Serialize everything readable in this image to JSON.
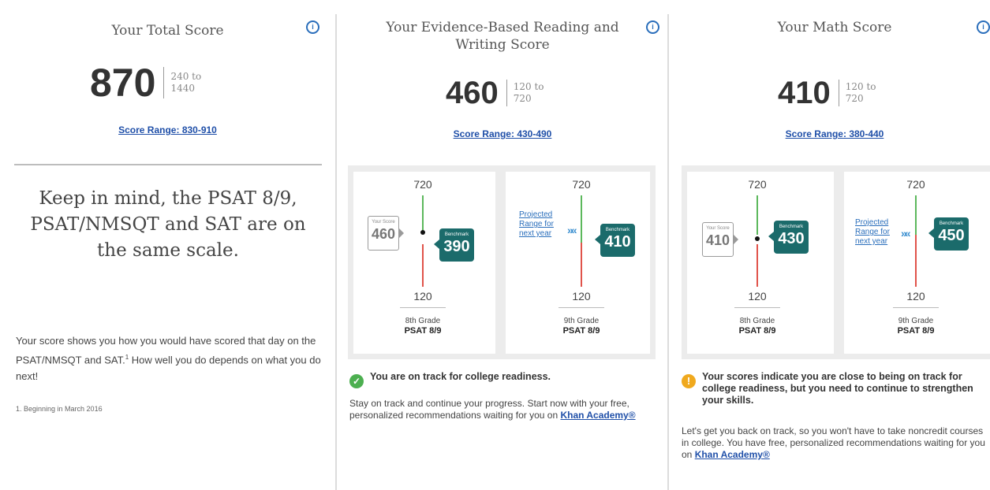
{
  "total": {
    "title": "Your Total Score",
    "score": "870",
    "range_from": "240 to",
    "range_to": "1440",
    "score_range": "Score Range: 830-910",
    "keep_in_mind": "Keep in mind, the PSAT 8/9, PSAT/NMSQT and SAT are on the same scale.",
    "explain_pre": "Your score shows you how you would have scored that day on the PSAT/NMSQT and SAT.",
    "explain_sup": "1",
    "explain_post": " How well you do depends on what you do next!",
    "footnote": "1. Beginning in March 2016"
  },
  "ebrw": {
    "title": "Your Evidence-Based Reading and Writing Score",
    "score": "460",
    "range_from": "120 to",
    "range_to": "720",
    "score_range": "Score Range: 430-490",
    "left": {
      "top": "720",
      "bottom": "120",
      "your_score_label": "Your Score",
      "your_score": "460",
      "benchmark_label": "Benchmark",
      "benchmark": "390",
      "grade": "8th Grade",
      "test": "PSAT 8/9"
    },
    "right": {
      "top": "720",
      "bottom": "120",
      "projected": "Projected Range for next year",
      "benchmark_label": "Benchmark",
      "benchmark": "410",
      "grade": "9th Grade",
      "test": "PSAT 8/9"
    },
    "status": "You are on track for college readiness.",
    "body": "Stay on track and continue your progress. Start now with your free, personalized recommendations waiting for you on ",
    "link": "Khan Academy®",
    "status_color": "#4caf50"
  },
  "math": {
    "title": "Your Math Score",
    "score": "410",
    "range_from": "120 to",
    "range_to": "720",
    "score_range": "Score Range: 380-440",
    "left": {
      "top": "720",
      "bottom": "120",
      "your_score_label": "Your Score",
      "your_score": "410",
      "benchmark_label": "Benchmark",
      "benchmark": "430",
      "grade": "8th Grade",
      "test": "PSAT 8/9"
    },
    "right": {
      "top": "720",
      "bottom": "120",
      "projected": "Projected Range for next year",
      "benchmark_label": "Benchmark",
      "benchmark": "450",
      "grade": "9th Grade",
      "test": "PSAT 8/9"
    },
    "status": "Your scores indicate you are close to being on track for college readiness, but you need to continue to strengthen your skills.",
    "body": "Let's get you back on track, so you won't have to take noncredit courses in college. You have free, personalized recommendations waiting for you on ",
    "link": "Khan Academy®",
    "status_color": "#f0a91e"
  },
  "icons": {
    "info": "info-icon",
    "ok": "check-circle-icon",
    "warn": "warning-circle-icon",
    "arrows": "double-chevron-icon"
  },
  "colors": {
    "teal": "#1b6b6b",
    "link": "#1f4fa8",
    "bar_green": "#5cb85c",
    "bar_red": "#e0534a"
  }
}
